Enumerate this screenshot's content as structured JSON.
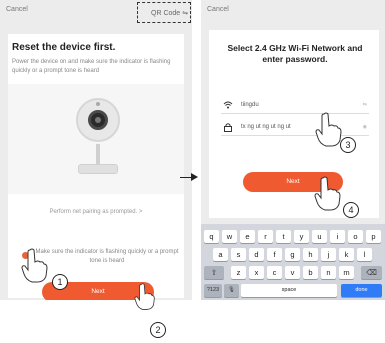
{
  "left_screen": {
    "cancel_label": "Cancel",
    "qr_label": "QR Code",
    "title": "Reset the device first.",
    "description": "Power the device on and make sure the indicator is flashing quickly or a prompt tone is heard",
    "link_text": "Perform net pairing as prompted. >",
    "checkbox_text": "Make sure the indicator is flashing quickly or a prompt tone is heard",
    "next_label": "Next"
  },
  "right_screen": {
    "cancel_label": "Cancel",
    "title": "Select 2.4 GHz Wi-Fi Network and enter password.",
    "ssid_value": "tiingdu",
    "password_value": "tx ng ut ng ut ng ut",
    "next_label": "Next",
    "keyboard": {
      "row1": [
        "q",
        "w",
        "e",
        "r",
        "t",
        "y",
        "u",
        "i",
        "o",
        "p"
      ],
      "row2": [
        "a",
        "s",
        "d",
        "f",
        "g",
        "h",
        "j",
        "k",
        "l"
      ],
      "row3": [
        "z",
        "x",
        "c",
        "v",
        "b",
        "n",
        "m"
      ],
      "shift_symbol": "⇧",
      "backspace_symbol": "⌫",
      "numbers_label": "?123",
      "mic_symbol": "🎙",
      "space_label": "space",
      "done_label": "done"
    }
  },
  "callouts": [
    "1",
    "2",
    "3",
    "4"
  ],
  "colors": {
    "accent": "#ef5a31",
    "keyboard_done": "#2f7cf6"
  }
}
